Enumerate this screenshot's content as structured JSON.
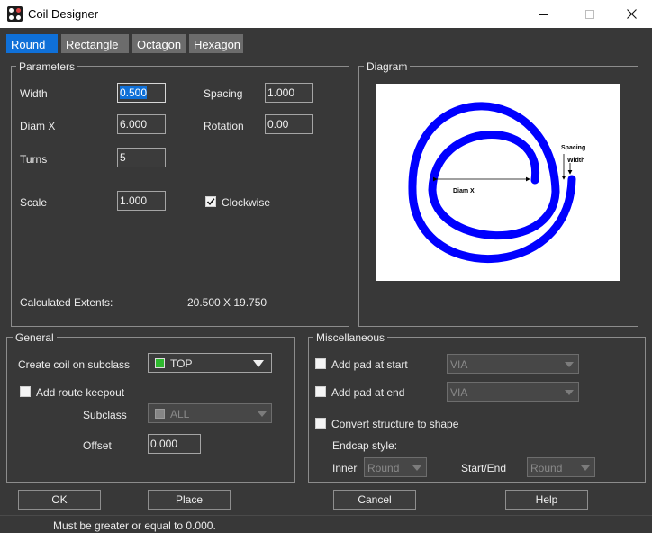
{
  "window": {
    "title": "Coil Designer",
    "minimize_icon": "minimize-icon",
    "maximize_icon": "maximize-icon",
    "close_icon": "close-icon"
  },
  "tabs": [
    {
      "label": "Round",
      "active": true
    },
    {
      "label": "Rectangle",
      "active": false
    },
    {
      "label": "Octagon",
      "active": false
    },
    {
      "label": "Hexagon",
      "active": false
    }
  ],
  "parameters": {
    "title": "Parameters",
    "width_label": "Width",
    "width_value": "0.500",
    "spacing_label": "Spacing",
    "spacing_value": "1.000",
    "diamx_label": "Diam X",
    "diamx_value": "6.000",
    "rotation_label": "Rotation",
    "rotation_value": "0.00",
    "turns_label": "Turns",
    "turns_value": "5",
    "scale_label": "Scale",
    "scale_value": "1.000",
    "clockwise_label": "Clockwise",
    "clockwise_checked": true,
    "extents_label": "Calculated Extents:",
    "extents_value": "20.500 X 19.750"
  },
  "diagram": {
    "title": "Diagram",
    "coil_color": "#0000ff",
    "spacing_text": "Spacing",
    "width_text": "Width",
    "diamx_text": "Diam X"
  },
  "general": {
    "title": "General",
    "create_coil_label": "Create coil on subclass",
    "subclass_value": "TOP",
    "subclass_swatch_color": "#2eb82e",
    "route_keepout_label": "Add route keepout",
    "route_keepout_checked": false,
    "keepout_subclass_label": "Subclass",
    "keepout_subclass_value": "ALL",
    "offset_label": "Offset",
    "offset_value": "0.000"
  },
  "misc": {
    "title": "Miscellaneous",
    "pad_start_label": "Add pad at start",
    "pad_start_checked": false,
    "pad_start_value": "VIA",
    "pad_end_label": "Add pad at end",
    "pad_end_checked": false,
    "pad_end_value": "VIA",
    "convert_label": "Convert structure to shape",
    "convert_checked": false,
    "endcap_label": "Endcap style:",
    "inner_label": "Inner",
    "inner_value": "Round",
    "startend_label": "Start/End",
    "startend_value": "Round"
  },
  "buttons": {
    "ok": "OK",
    "place": "Place",
    "cancel": "Cancel",
    "help": "Help"
  },
  "status": {
    "message": "Must be greater or equal to 0.000."
  }
}
